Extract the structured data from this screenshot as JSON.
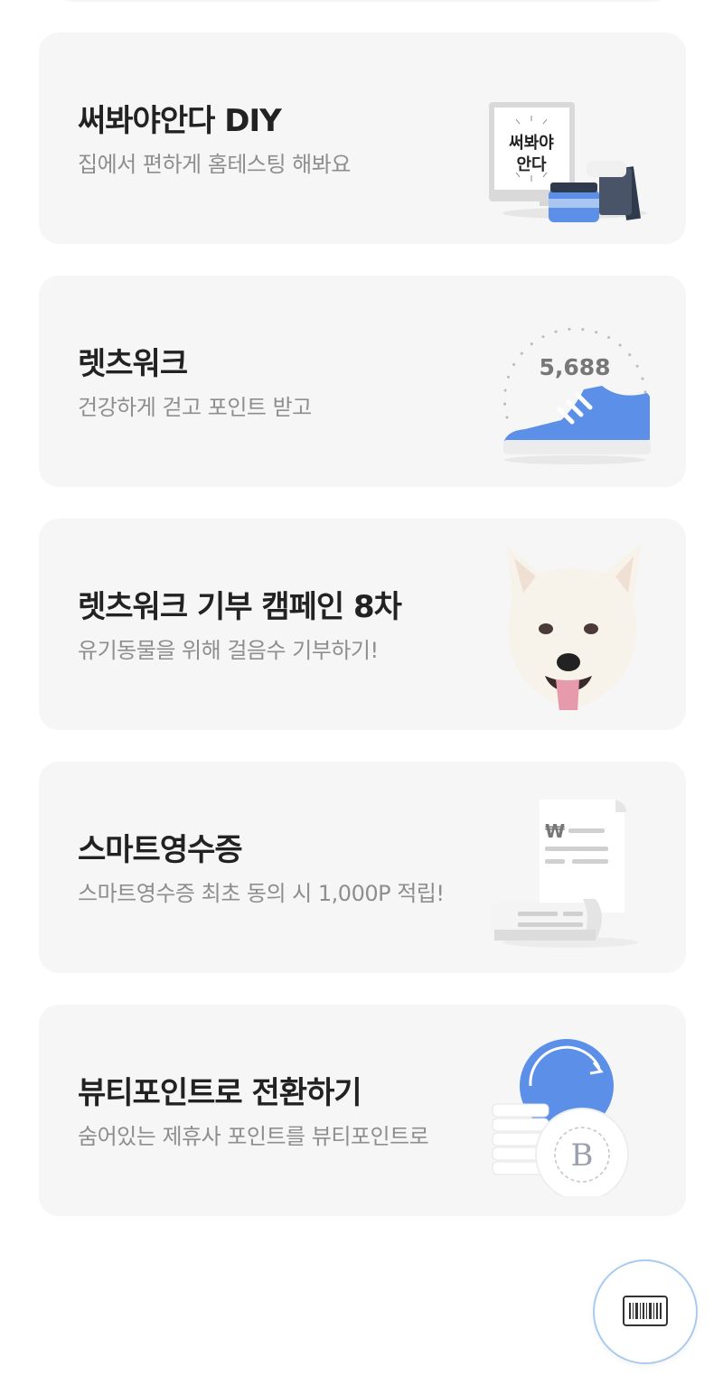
{
  "cards": [
    {
      "title": "써봐야안다 DIY",
      "subtitle": "집에서 편하게 홈테스팅 해봐요",
      "illustration": "monitor-cosmetics-illustration",
      "badge_line1": "써봐야",
      "badge_line2": "안다"
    },
    {
      "title": "렛츠워크",
      "subtitle": "건강하게 걷고 포인트 받고",
      "illustration": "sneaker-step-counter-illustration",
      "step_count": "5,688"
    },
    {
      "title": "렛츠워크 기부 캠페인 8차",
      "subtitle": "유기동물을 위해 걸음수 기부하기!",
      "illustration": "white-dog-photo"
    },
    {
      "title": "스마트영수증",
      "subtitle": "스마트영수증 최초 동의 시 1,000P 적립!",
      "illustration": "receipt-illustration",
      "currency_symbol": "₩"
    },
    {
      "title": "뷰티포인트로 전환하기",
      "subtitle": "숨어있는 제휴사 포인트를 뷰티포인트로",
      "illustration": "point-conversion-illustration",
      "coin_letter": "B"
    }
  ],
  "floating_button": {
    "icon": "barcode-icon"
  },
  "colors": {
    "card_bg": "#f6f6f6",
    "title": "#222222",
    "subtitle": "#8e8e8e",
    "accent_blue": "#5b8fe8",
    "button_border": "#a9cbf0"
  }
}
